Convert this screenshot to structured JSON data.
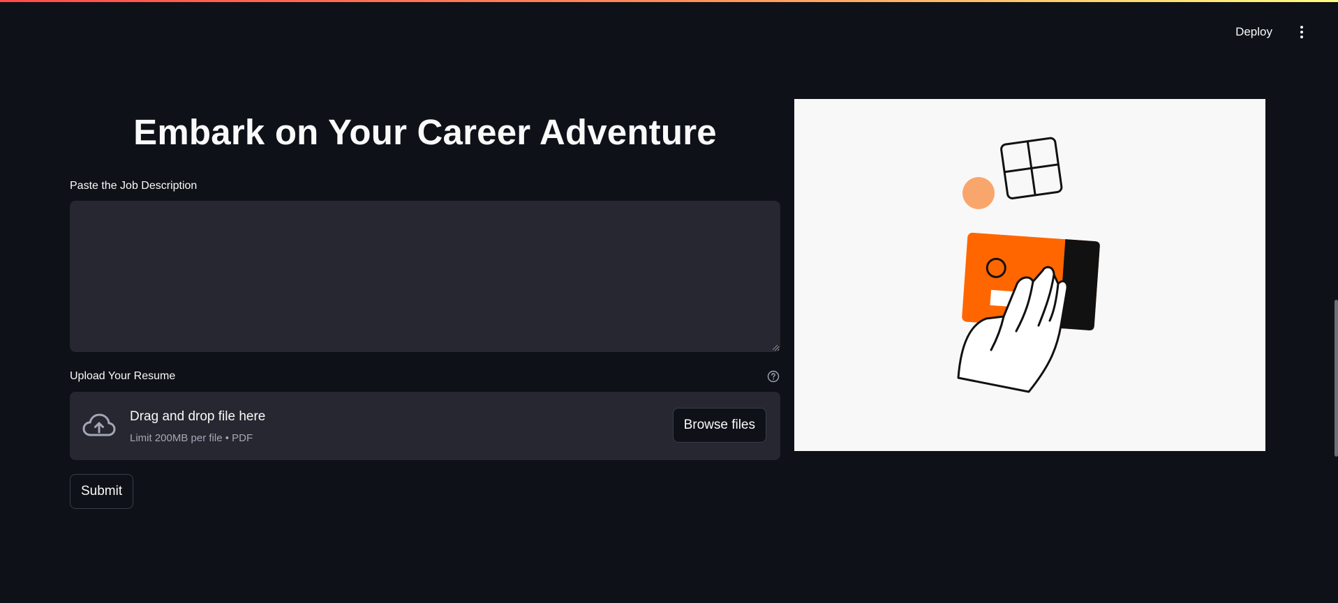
{
  "header": {
    "deploy_label": "Deploy",
    "menu_icon": "more-vertical-icon"
  },
  "main": {
    "title": "Embark on Your Career Adventure",
    "job_description": {
      "label": "Paste the Job Description",
      "value": "",
      "placeholder": ""
    },
    "resume_upload": {
      "label": "Upload Your Resume",
      "help_icon": "help-circle-icon",
      "upload_icon": "cloud-upload-icon",
      "dropzone_title": "Drag and drop file here",
      "dropzone_subtitle": "Limit 200MB per file • PDF",
      "browse_label": "Browse files"
    },
    "submit_label": "Submit"
  },
  "illustration": {
    "description_icon": "hand-holding-card-illustration",
    "colors": {
      "card": "#ff6600",
      "circle": "#f9a66c",
      "stripe": "#111111",
      "background": "#f8f8f8"
    }
  },
  "theme": {
    "background": "#0e1117",
    "surface": "#262730",
    "text": "#fafafa",
    "muted_text": "#a3a8b8",
    "accent_gradient": [
      "#ff4b4b",
      "#fffd80"
    ]
  }
}
